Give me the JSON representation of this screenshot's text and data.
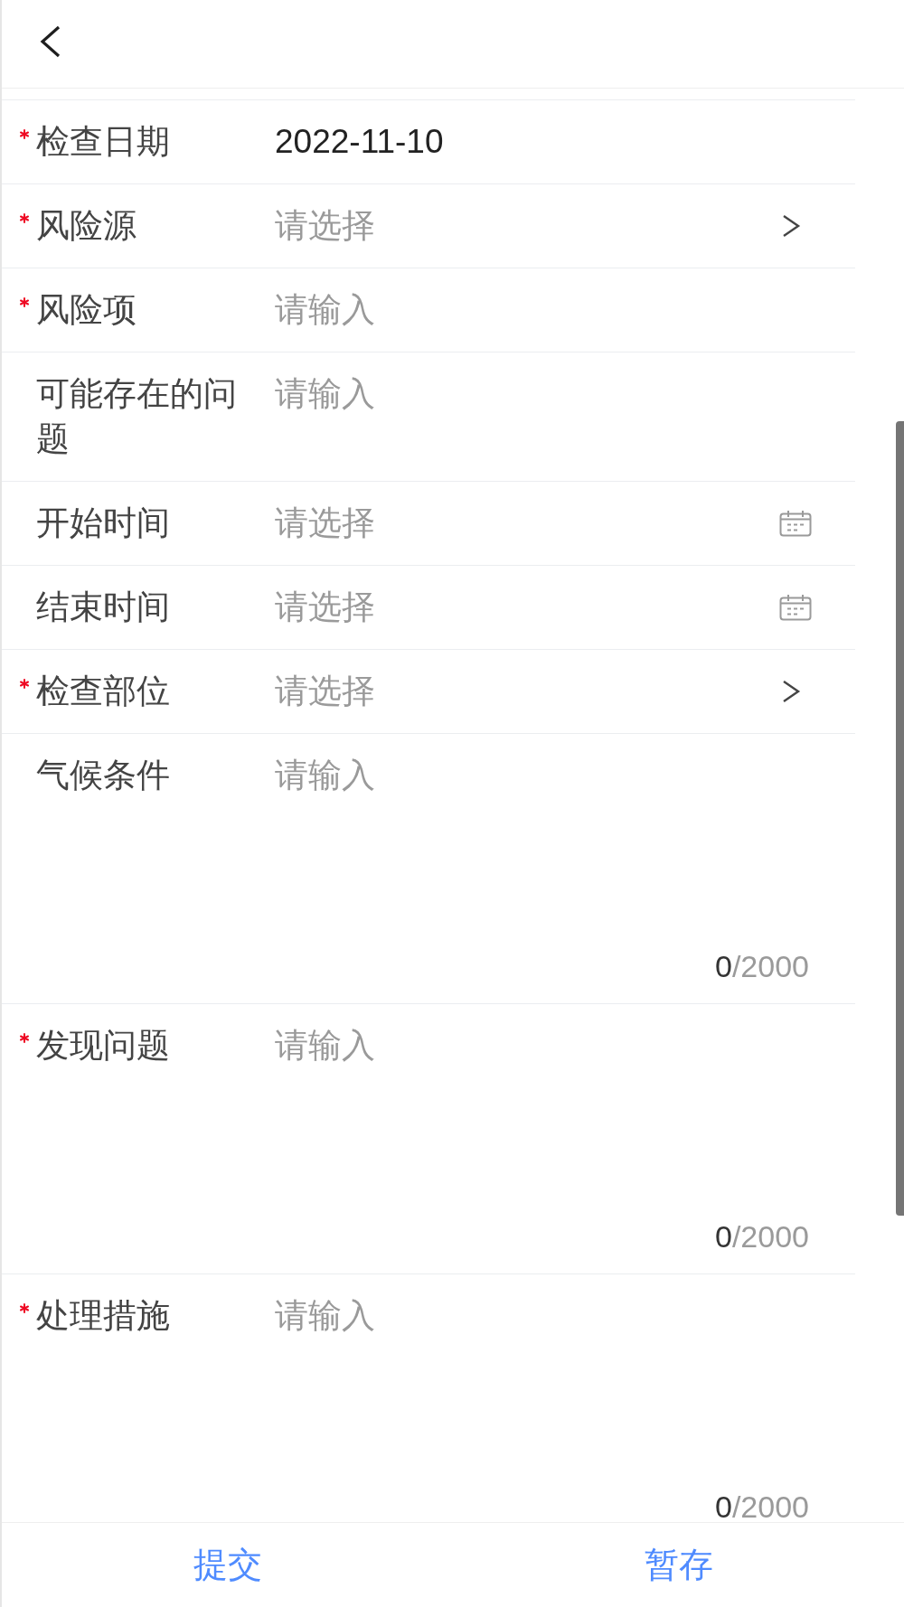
{
  "fields": [
    {
      "kind": "input",
      "label": "检查日期",
      "required": true,
      "value": "2022-11-10"
    },
    {
      "kind": "select",
      "label": "风险源",
      "required": true,
      "placeholder": "请选择"
    },
    {
      "kind": "input",
      "label": "风险项",
      "required": true,
      "placeholder": "请输入"
    },
    {
      "kind": "input",
      "label": "可能存在的问题",
      "required": false,
      "placeholder": "请输入"
    },
    {
      "kind": "date",
      "label": "开始时间",
      "required": false,
      "placeholder": "请选择"
    },
    {
      "kind": "date",
      "label": "结束时间",
      "required": false,
      "placeholder": "请选择"
    },
    {
      "kind": "select",
      "label": "检查部位",
      "required": true,
      "placeholder": "请选择"
    },
    {
      "kind": "textarea",
      "label": "气候条件",
      "required": false,
      "placeholder": "请输入",
      "count": "0",
      "limit": "/2000"
    },
    {
      "kind": "textarea",
      "label": "发现问题",
      "required": true,
      "placeholder": "请输入",
      "count": "0",
      "limit": "/2000"
    },
    {
      "kind": "textarea",
      "label": "处理措施",
      "required": true,
      "placeholder": "请输入",
      "count": "0",
      "limit": "/2000"
    }
  ],
  "buttons": [
    "提交",
    "暂存"
  ]
}
